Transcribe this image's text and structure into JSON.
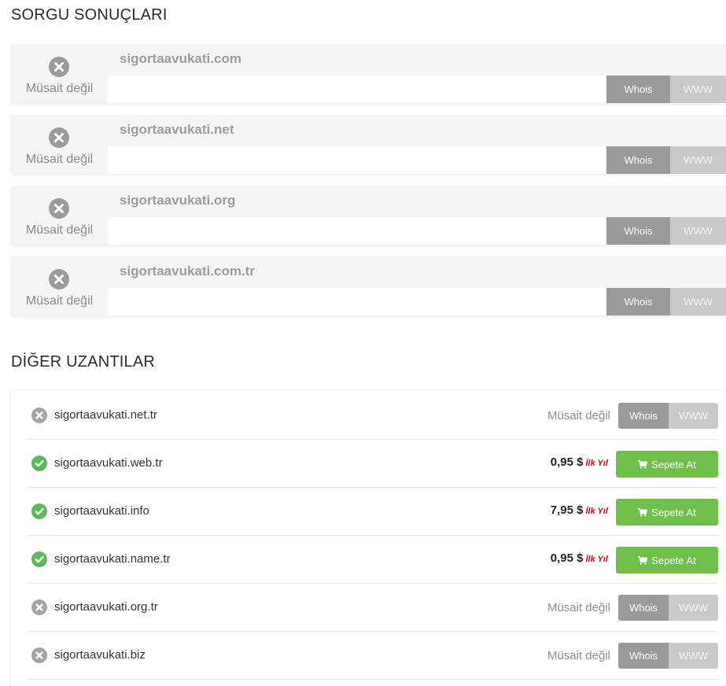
{
  "sections": {
    "results_title": "SORGU SONUÇLARI",
    "other_title": "DİĞER UZANTILAR"
  },
  "results": [
    {
      "domain": "sigortaavukati.com",
      "status": "Müsait değil",
      "whois": "Whois",
      "www": "WWW"
    },
    {
      "domain": "sigortaavukati.net",
      "status": "Müsait değil",
      "whois": "Whois",
      "www": "WWW"
    },
    {
      "domain": "sigortaavukati.org",
      "status": "Müsait değil",
      "whois": "Whois",
      "www": "WWW"
    },
    {
      "domain": "sigortaavukati.com.tr",
      "status": "Müsait değil",
      "whois": "Whois",
      "www": "WWW"
    }
  ],
  "other": [
    {
      "domain": "sigortaavukati.net.tr",
      "available": false,
      "status": "Müsait değil",
      "whois": "Whois",
      "www": "WWW"
    },
    {
      "domain": "sigortaavukati.web.tr",
      "available": true,
      "price": "0,95 $",
      "period": "İlk Yıl",
      "cart": "Sepete At"
    },
    {
      "domain": "sigortaavukati.info",
      "available": true,
      "price": "7,95 $",
      "period": "İlk Yıl",
      "cart": "Sepete At"
    },
    {
      "domain": "sigortaavukati.name.tr",
      "available": true,
      "price": "0,95 $",
      "period": "İlk Yıl",
      "cart": "Sepete At"
    },
    {
      "domain": "sigortaavukati.org.tr",
      "available": false,
      "status": "Müsait değil",
      "whois": "Whois",
      "www": "WWW"
    },
    {
      "domain": "sigortaavukati.biz",
      "available": false,
      "status": "Müsait değil",
      "whois": "Whois",
      "www": "WWW"
    }
  ],
  "icons": {
    "unavailable": "x-circle-icon",
    "available": "check-circle-icon",
    "cart": "shopping-cart-icon"
  },
  "colors": {
    "unavailable_icon": "#9b9b9b",
    "available_icon": "#5cb85c",
    "cart_button": "#6fbf4a",
    "whois_button": "#9a9a9a",
    "www_button": "#c9c9c9",
    "period_text": "#b5121b"
  }
}
